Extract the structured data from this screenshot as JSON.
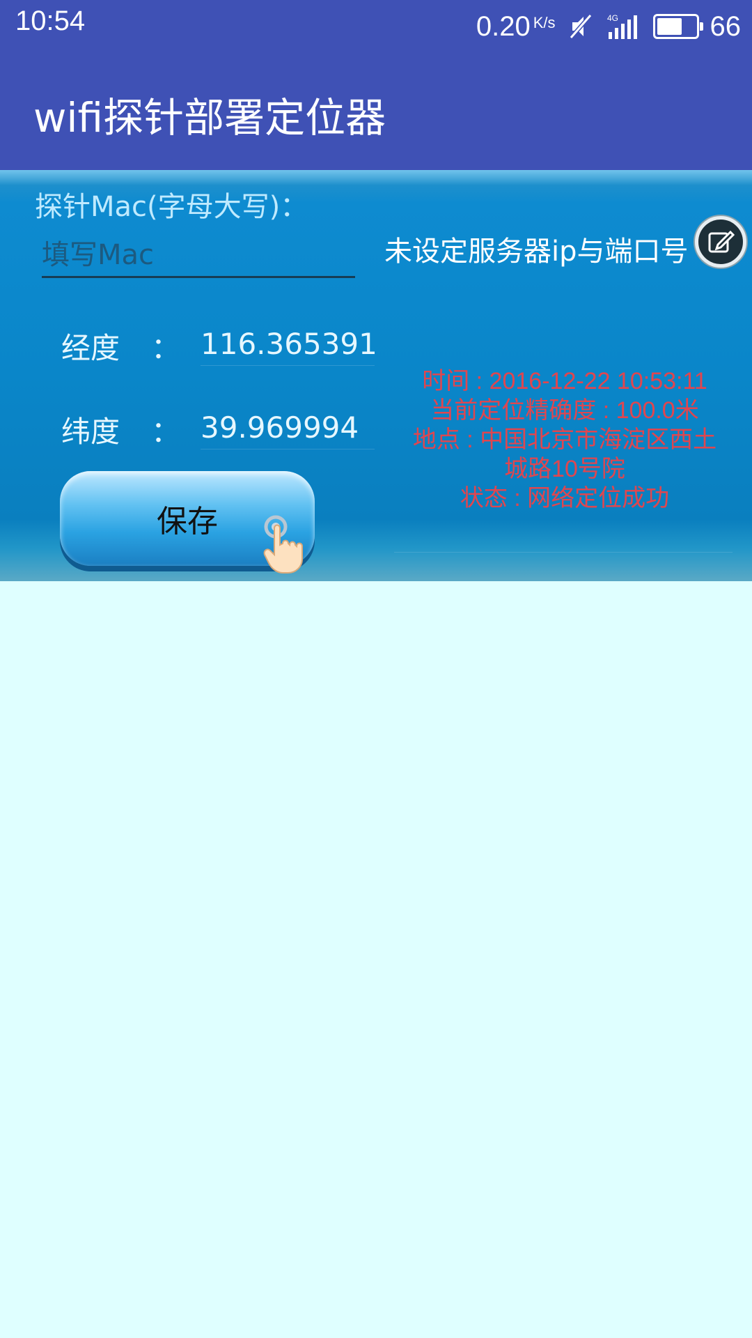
{
  "status_bar": {
    "time": "10:54",
    "speed": "0.20",
    "speed_unit": "K/s",
    "network": "4G",
    "battery": "66",
    "battery_level": 0.66,
    "icons": [
      "mute-icon",
      "signal-icon",
      "battery-icon"
    ]
  },
  "app_bar": {
    "title": "wifi探针部署定位器"
  },
  "form": {
    "mac_label": "探针Mac(字母大写)：",
    "mac_placeholder": "填写Mac",
    "mac_value": "",
    "longitude_label": "经度",
    "longitude_value": "116.365391",
    "latitude_label": "纬度",
    "latitude_value": "39.969994",
    "colon": "：",
    "save_label": "保存"
  },
  "server": {
    "hint": "未设定服务器ip与端口号",
    "edit_icon": "edit-icon"
  },
  "info": {
    "time": "时间 : 2016-12-22 10:53:11",
    "accuracy": "当前定位精确度 : 100.0米",
    "location_1": "地点 : 中国北京市海淀区西土",
    "location_2": "城路10号院",
    "status": "状态 : 网络定位成功"
  },
  "colors": {
    "primary": "#3F51B5",
    "background": "#DFFFFF",
    "info_text": "#E0464F"
  }
}
